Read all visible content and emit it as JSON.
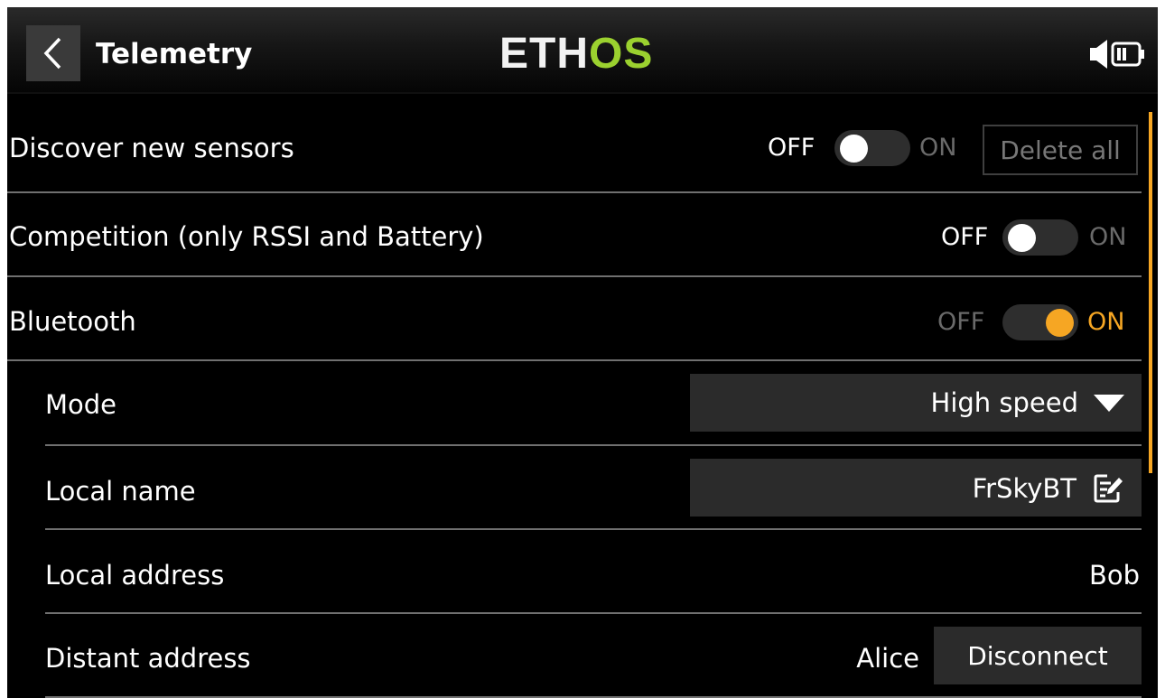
{
  "header": {
    "back_icon": "chevron-left-icon",
    "title": "Telemetry",
    "logo_part1": "ETH",
    "logo_part2": "OS",
    "logo_colors": {
      "part1": "#f2f2f2",
      "part2": "#9bd12f"
    },
    "status_icons": [
      "speaker-icon",
      "battery-icon"
    ]
  },
  "accent_color": "#f6a623",
  "settings": {
    "discover": {
      "label": "Discover new sensors",
      "off": "OFF",
      "on": "ON",
      "state": "off",
      "delete_label": "Delete all"
    },
    "competition": {
      "label": "Competition (only RSSI and Battery)",
      "off": "OFF",
      "on": "ON",
      "state": "off"
    },
    "bluetooth": {
      "label": "Bluetooth",
      "off": "OFF",
      "on": "ON",
      "state": "on"
    },
    "mode": {
      "label": "Mode",
      "value": "High speed",
      "icon": "dropdown-triangle-icon"
    },
    "local_name": {
      "label": "Local name",
      "value": "FrSkyBT",
      "icon": "edit-icon"
    },
    "local_address": {
      "label": "Local address",
      "value": "Bob"
    },
    "distant_address": {
      "label": "Distant address",
      "value": "Alice",
      "button": "Disconnect"
    }
  }
}
